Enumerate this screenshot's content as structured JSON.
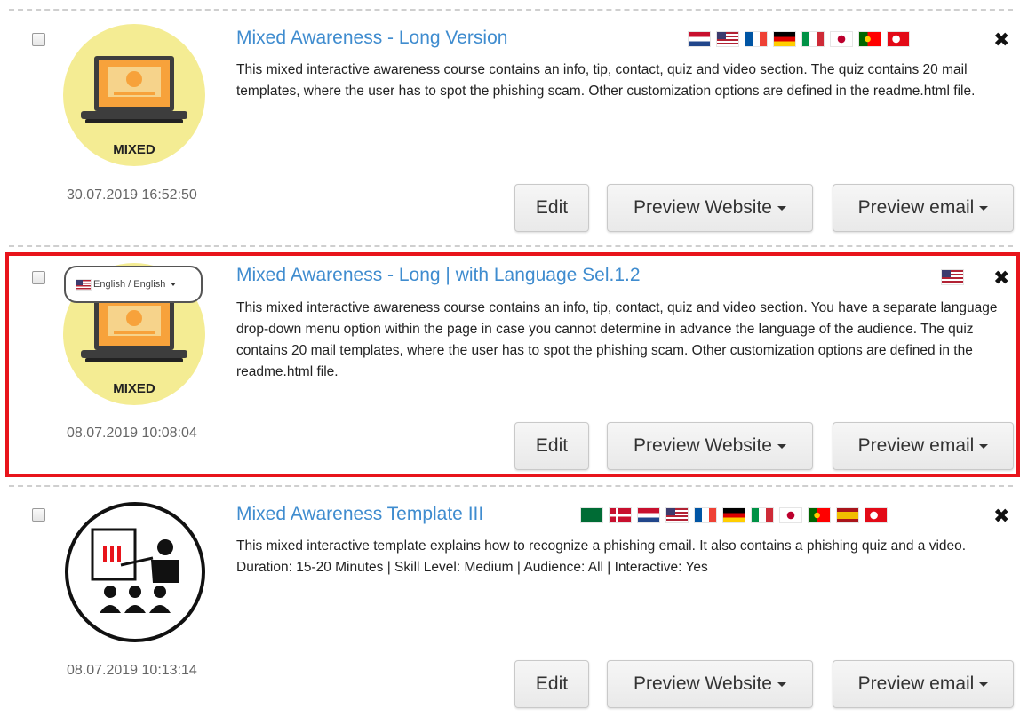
{
  "courses": [
    {
      "title": "Mixed Awareness - Long Version",
      "description": "This mixed interactive awareness course contains an info, tip, contact, quiz and video section. The quiz contains 20 mail templates, where the user has to spot the phishing scam. Other customization options are defined in the readme.html file.",
      "date": "30.07.2019 16:52:50",
      "thumb_label": "MIXED",
      "flags": [
        "nl",
        "us",
        "fr",
        "de",
        "it",
        "jp",
        "pt",
        "tr"
      ]
    },
    {
      "title": "Mixed Awareness - Long | with Language Sel.1.2",
      "description": "This mixed interactive awareness course contains an info, tip, contact, quiz and video section. You have a separate language drop-down menu option within the page in case you cannot determine in advance the language of the audience. The quiz contains 20 mail templates, where the user has to spot the phishing scam. Other customization options are defined in the readme.html file.",
      "date": "08.07.2019 10:08:04",
      "thumb_label": "MIXED",
      "language_selector": "English / English",
      "flags": [
        "us"
      ]
    },
    {
      "title": "Mixed Awareness Template III",
      "description": "This mixed interactive template explains how to recognize a phishing email. It also contains a phishing quiz and a video. Duration: 15-20 Minutes | Skill Level: Medium | Audience: All | Interactive: Yes",
      "date": "08.07.2019 10:13:14",
      "flags": [
        "sa",
        "dk",
        "nl",
        "us",
        "fr",
        "de",
        "it",
        "jp",
        "pt",
        "es",
        "tr"
      ]
    }
  ],
  "buttons": {
    "edit": "Edit",
    "preview_website": "Preview Website",
    "preview_email": "Preview email"
  },
  "close_glyph": "✖",
  "colors": {
    "title": "#3f8ccf",
    "highlight_border": "#e8141b",
    "thumb_bg": "#f4ec93"
  }
}
